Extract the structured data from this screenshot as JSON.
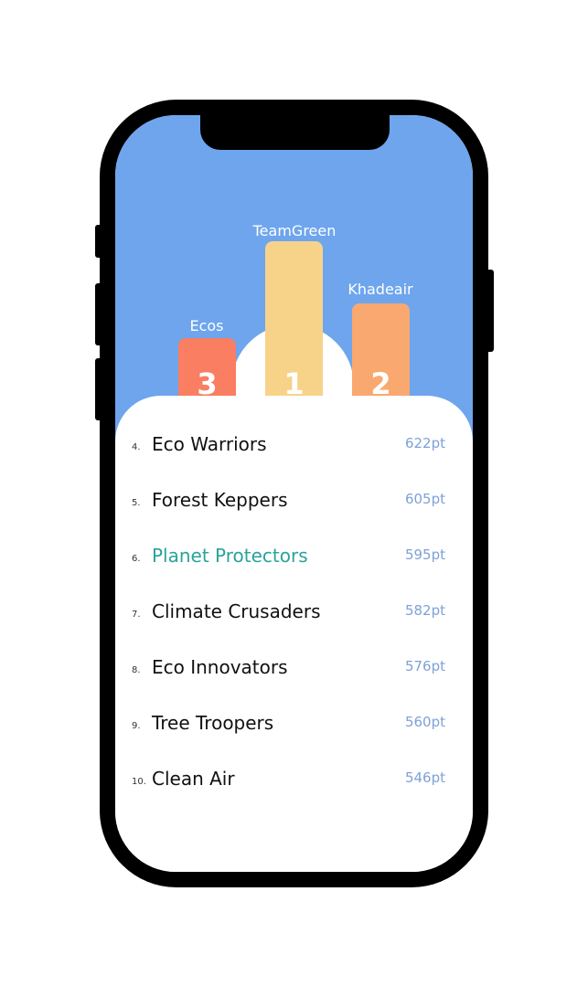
{
  "podium": [
    {
      "rank": "3",
      "team": "Ecos",
      "color": "#f97e62"
    },
    {
      "rank": "1",
      "team": "TeamGreen",
      "color": "#f7d38a"
    },
    {
      "rank": "2",
      "team": "Khadeair",
      "color": "#f9a870"
    }
  ],
  "leaderboard": [
    {
      "rank": "4.",
      "team": "Eco Warriors",
      "points": "622pt",
      "highlight": false
    },
    {
      "rank": "5.",
      "team": "Forest Keppers",
      "points": "605pt",
      "highlight": false
    },
    {
      "rank": "6.",
      "team": "Planet Protectors",
      "points": "595pt",
      "highlight": true
    },
    {
      "rank": "7.",
      "team": "Climate Crusaders",
      "points": "582pt",
      "highlight": false
    },
    {
      "rank": "8.",
      "team": "Eco Innovators",
      "points": "576pt",
      "highlight": false
    },
    {
      "rank": "9.",
      "team": "Tree Troopers",
      "points": "560pt",
      "highlight": false
    },
    {
      "rank": "10.",
      "team": "Clean Air",
      "points": "546pt",
      "highlight": false
    }
  ],
  "colors": {
    "sky": "#6ea5ed",
    "highlight_text": "#2aa39a",
    "points_text": "#7ea1d8"
  }
}
